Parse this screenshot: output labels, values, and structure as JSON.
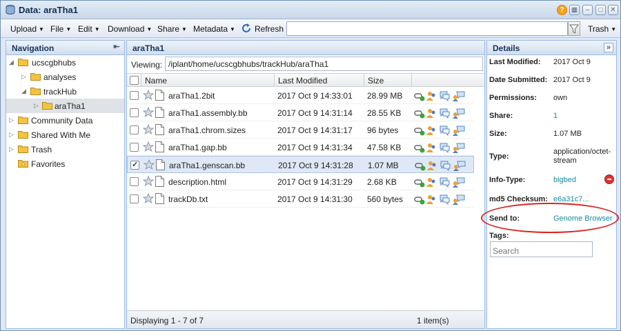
{
  "window": {
    "title": "Data: araTha1"
  },
  "toolbar": {
    "upload_label": "Upload",
    "file_label": "File",
    "edit_label": "Edit",
    "download_label": "Download",
    "share_label": "Share",
    "metadata_label": "Metadata",
    "refresh_label": "Refresh",
    "trash_label": "Trash",
    "search_value": ""
  },
  "navigation": {
    "title": "Navigation",
    "items": [
      {
        "label": "ucscgbhubs"
      },
      {
        "label": "analyses"
      },
      {
        "label": "trackHub"
      },
      {
        "label": "araTha1"
      },
      {
        "label": "Community Data"
      },
      {
        "label": "Shared With Me"
      },
      {
        "label": "Trash"
      },
      {
        "label": "Favorites"
      }
    ]
  },
  "center": {
    "title": "araTha1",
    "viewing_label": "Viewing:",
    "path": "/iplant/home/ucscgbhubs/trackHub/araTha1",
    "columns": {
      "name": "Name",
      "modified": "Last Modified",
      "size": "Size"
    },
    "rows": [
      {
        "name": "araTha1.2bit",
        "modified": "2017 Oct 9 14:33:01",
        "size": "28.99 MB",
        "checked": false
      },
      {
        "name": "araTha1.assembly.bb",
        "modified": "2017 Oct 9 14:31:14",
        "size": "28.55 KB",
        "checked": false
      },
      {
        "name": "araTha1.chrom.sizes",
        "modified": "2017 Oct 9 14:31:17",
        "size": "96 bytes",
        "checked": false
      },
      {
        "name": "araTha1.gap.bb",
        "modified": "2017 Oct 9 14:31:34",
        "size": "47.58 KB",
        "checked": false
      },
      {
        "name": "araTha1.genscan.bb",
        "modified": "2017 Oct 9 14:31:28",
        "size": "1.07 MB",
        "checked": true
      },
      {
        "name": "description.html",
        "modified": "2017 Oct 9 14:31:29",
        "size": "2.68 KB",
        "checked": false
      },
      {
        "name": "trackDb.txt",
        "modified": "2017 Oct 9 14:31:30",
        "size": "560 bytes",
        "checked": false
      }
    ],
    "footer_display": "Displaying 1 - 7 of 7",
    "footer_selected": "1 item(s)"
  },
  "details": {
    "title": "Details",
    "last_modified_label": "Last Modified:",
    "last_modified": "2017 Oct 9",
    "date_submitted_label": "Date Submitted:",
    "date_submitted": "2017 Oct 9",
    "permissions_label": "Permissions:",
    "permissions": "own",
    "share_label": "Share:",
    "share": "1",
    "size_label": "Size:",
    "size": "1.07 MB",
    "type_label": "Type:",
    "type_line1": "application/octet-",
    "type_line2": "stream",
    "info_type_label": "Info-Type:",
    "info_type": "bigbed",
    "md5_label": "md5 Checksum:",
    "md5": "e6a31c7...",
    "send_to_label": "Send to:",
    "send_to": "Genome Browser",
    "tags_label": "Tags:",
    "tags_placeholder": "Search"
  },
  "colors": {
    "link": "#178aa0",
    "highlight_annotation": "#dd2222",
    "selected_row": "#dfe8f6"
  }
}
